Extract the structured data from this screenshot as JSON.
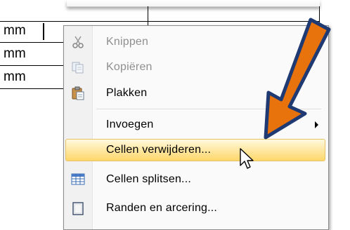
{
  "document": {
    "cells": [
      "mm",
      "mm",
      "mm"
    ]
  },
  "context_menu": {
    "items": [
      {
        "label": "Knippen",
        "icon": "scissors-icon",
        "disabled": true
      },
      {
        "label": "Kopiëren",
        "icon": "copy-icon",
        "disabled": true
      },
      {
        "label": "Plakken",
        "icon": "paste-icon",
        "disabled": false
      },
      {
        "label": "Invoegen",
        "icon": "",
        "disabled": false,
        "submenu": true
      },
      {
        "label": "Cellen verwijderen...",
        "icon": "",
        "disabled": false,
        "highlighted": true
      },
      {
        "label": "Cellen splitsen...",
        "icon": "split-cells-icon",
        "disabled": false
      },
      {
        "label": "Randen en arcering...",
        "icon": "borders-icon",
        "disabled": false
      }
    ]
  },
  "colors": {
    "highlight_top": "#fff9df",
    "highlight_bottom": "#ffd76b",
    "arrow_fill": "#e8720c",
    "arrow_outline": "#1f3a73"
  }
}
